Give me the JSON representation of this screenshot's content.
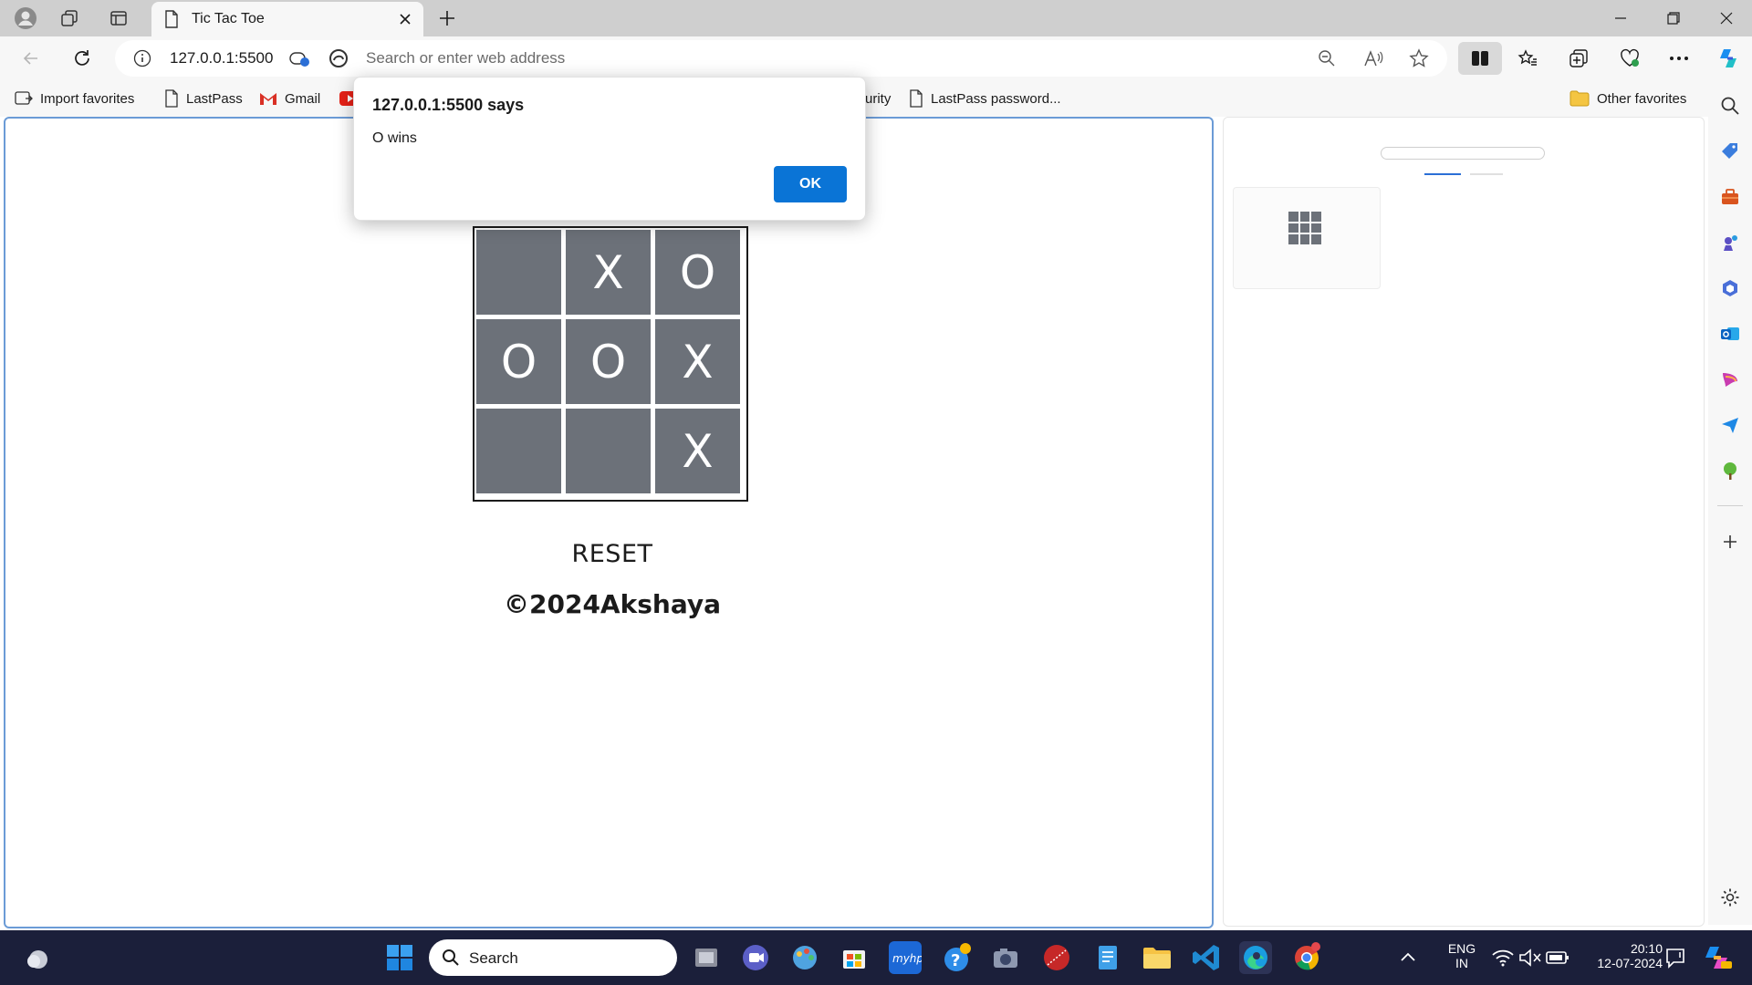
{
  "browser": {
    "tab_title": "Tic Tac Toe",
    "url": "127.0.0.1:5500",
    "address_placeholder": "Search or enter web address"
  },
  "favorites": {
    "items": [
      {
        "label": "Import favorites",
        "icon": "import-icon"
      },
      {
        "label": "LastPass",
        "icon": "page-icon"
      },
      {
        "label": "Gmail",
        "icon": "gmail-icon"
      },
      {
        "label": "urity",
        "icon": ""
      },
      {
        "label": "LastPass password...",
        "icon": "page-icon"
      }
    ],
    "other_label": "Other favorites"
  },
  "dialog": {
    "title": "127.0.0.1:5500 says",
    "message": "O wins",
    "ok_label": "OK"
  },
  "game": {
    "cells": [
      "",
      "X",
      "O",
      "O",
      "O",
      "X",
      "",
      "",
      "X"
    ],
    "reset_label": "RESET",
    "footer": "©2024Akshaya",
    "cell_color": "#6c7179"
  },
  "taskbar": {
    "search_label": "Search",
    "lang_line1": "ENG",
    "lang_line2": "IN",
    "time": "20:10",
    "date": "12-07-2024"
  },
  "colors": {
    "accent": "#0a74d6",
    "content_border": "#6b9bd6",
    "taskbar_bg": "#1b1f3a"
  }
}
